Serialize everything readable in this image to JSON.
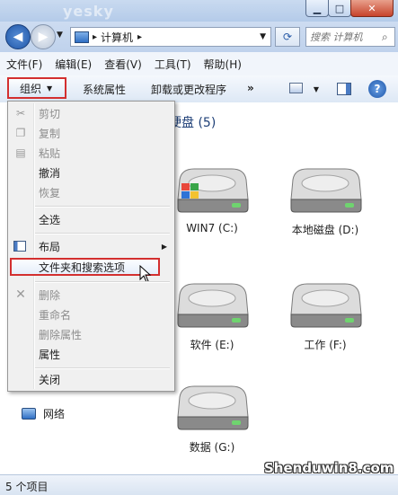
{
  "titlebar": {
    "min_glyph": "▁",
    "max_glyph": "□",
    "close_glyph": "✕"
  },
  "nav": {
    "address_segments": [
      "计算机"
    ],
    "address_separator": "▸",
    "search_placeholder": "搜索 计算机"
  },
  "menubar": {
    "items": [
      "文件(F)",
      "编辑(E)",
      "查看(V)",
      "工具(T)",
      "帮助(H)"
    ]
  },
  "toolbar": {
    "organize_label": "组织",
    "system_properties_label": "系统属性",
    "uninstall_label": "卸载或更改程序",
    "more_label": "»"
  },
  "content": {
    "group_header": "硬盘 (5)",
    "drives": [
      {
        "label": "WIN7 (C:)",
        "os_badge": true
      },
      {
        "label": "本地磁盘 (D:)",
        "os_badge": false
      },
      {
        "label": "软件 (E:)",
        "os_badge": false
      },
      {
        "label": "工作 (F:)",
        "os_badge": false
      },
      {
        "label": "数据 (G:)",
        "os_badge": false
      }
    ]
  },
  "leftpane": {
    "network_label": "网络"
  },
  "organize_menu": {
    "items": [
      {
        "label": "剪切",
        "disabled": true,
        "icon": "scissors-icon"
      },
      {
        "label": "复制",
        "disabled": true,
        "icon": "copy-icon"
      },
      {
        "label": "粘贴",
        "disabled": true,
        "icon": "paste-icon"
      },
      {
        "label": "撤消",
        "disabled": false
      },
      {
        "label": "恢复",
        "disabled": true
      },
      {
        "label": "全选",
        "disabled": false
      },
      {
        "label": "布局",
        "disabled": false,
        "icon": "layout-icon",
        "submenu": true
      },
      {
        "label": "文件夹和搜索选项",
        "disabled": false,
        "highlighted": true
      },
      {
        "label": "删除",
        "disabled": true,
        "icon": "delete-x-icon"
      },
      {
        "label": "重命名",
        "disabled": true
      },
      {
        "label": "删除属性",
        "disabled": true
      },
      {
        "label": "属性",
        "disabled": false
      },
      {
        "label": "关闭",
        "disabled": false
      }
    ]
  },
  "statusbar": {
    "text": "5 个项目"
  },
  "watermarks": {
    "top": "yesky",
    "bottom": "Shenduwin8.com"
  },
  "colors": {
    "highlight_border": "#d32f2f",
    "accent": "#1e56a8"
  }
}
